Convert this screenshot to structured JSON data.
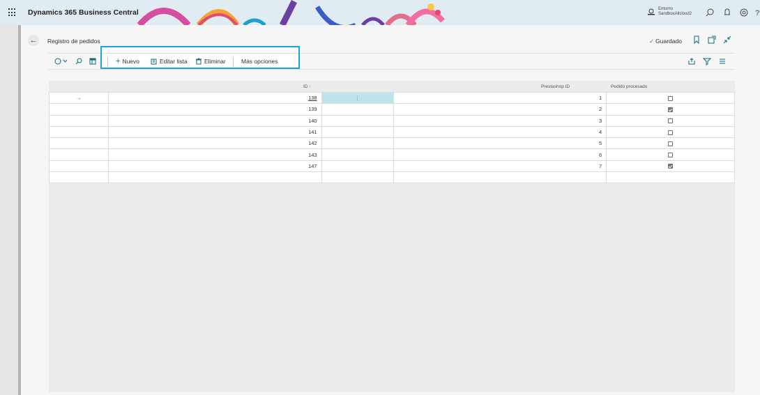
{
  "app": {
    "title": "Dynamics 365 Business Central",
    "env_label": "Entorno",
    "env_name": "SandboxAllcloud2"
  },
  "page": {
    "title": "Registro de pedidos",
    "saved_label": "Guardado"
  },
  "actions": {
    "new_label": "Nuevo",
    "edit_list_label": "Editar lista",
    "delete_label": "Eliminar",
    "more_label": "Más opciones"
  },
  "table": {
    "headers": {
      "id": "ID ↑",
      "prestashop_id": "Prestashop ID",
      "processed": "Pedido procesado"
    },
    "rows": [
      {
        "id": "138",
        "prestashop_id": "1",
        "processed": false
      },
      {
        "id": "139",
        "prestashop_id": "2",
        "processed": true
      },
      {
        "id": "140",
        "prestashop_id": "3",
        "processed": false
      },
      {
        "id": "141",
        "prestashop_id": "4",
        "processed": false
      },
      {
        "id": "142",
        "prestashop_id": "5",
        "processed": false
      },
      {
        "id": "143",
        "prestashop_id": "6",
        "processed": false
      },
      {
        "id": "147",
        "prestashop_id": "7",
        "processed": true
      }
    ]
  },
  "colors": {
    "accent": "#0b6a7c",
    "highlight": "#1aa3dc",
    "selected_cell": "#bde4ec"
  }
}
